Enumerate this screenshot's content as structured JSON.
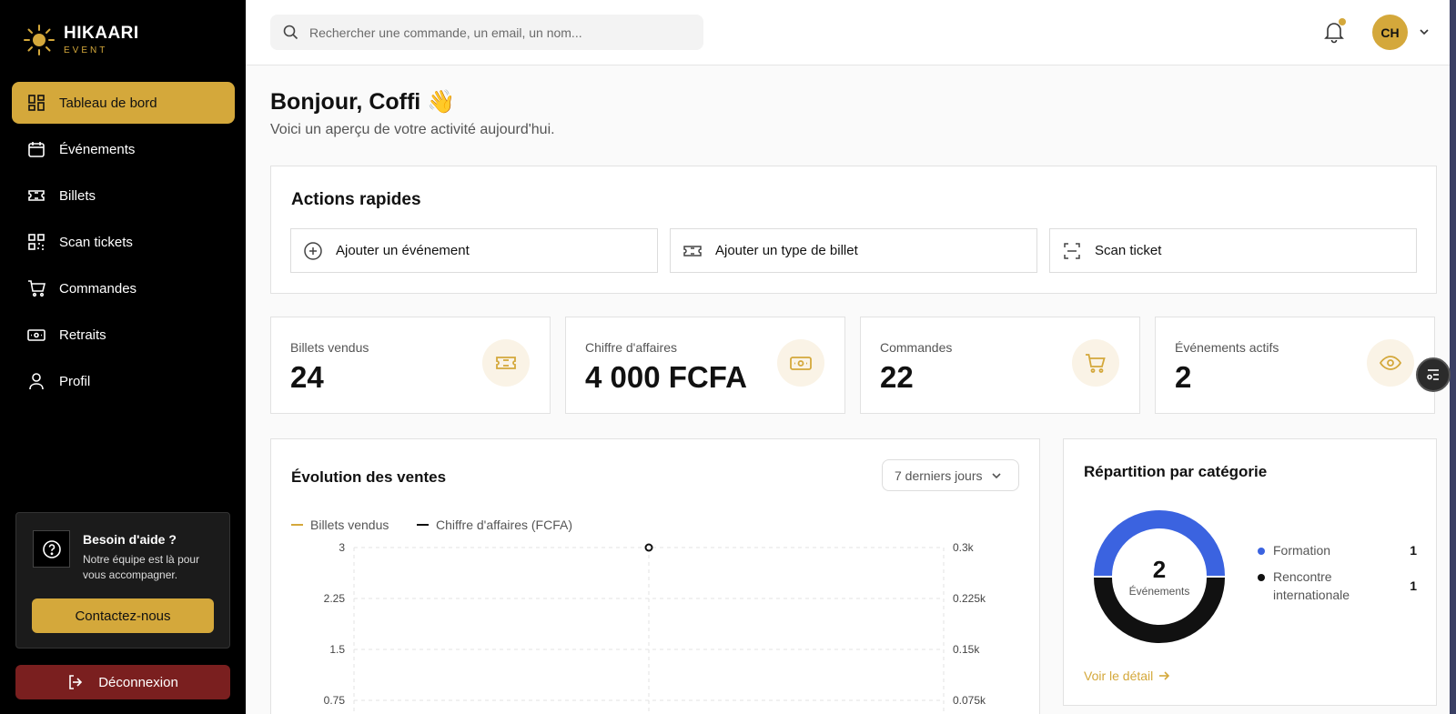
{
  "brand": {
    "name": "HIKAARI",
    "sub": "EVENT"
  },
  "sidebar": {
    "items": [
      {
        "label": "Tableau de bord",
        "icon": "dashboard-icon",
        "active": true
      },
      {
        "label": "Événements",
        "icon": "calendar-icon"
      },
      {
        "label": "Billets",
        "icon": "ticket-icon"
      },
      {
        "label": "Scan tickets",
        "icon": "qr-code-icon"
      },
      {
        "label": "Commandes",
        "icon": "cart-icon"
      },
      {
        "label": "Retraits",
        "icon": "banknote-icon"
      },
      {
        "label": "Profil",
        "icon": "user-icon"
      }
    ],
    "help": {
      "title": "Besoin d'aide ?",
      "text": "Notre équipe est là pour vous accompagner.",
      "button": "Contactez-nous"
    },
    "logout": "Déconnexion"
  },
  "topbar": {
    "search_placeholder": "Rechercher une commande, un email, un nom...",
    "avatar_initials": "CH"
  },
  "greeting": {
    "title": "Bonjour, Coffi 👋",
    "subtitle": "Voici un aperçu de votre activité aujourd'hui."
  },
  "quick_actions": {
    "title": "Actions rapides",
    "items": [
      {
        "label": "Ajouter un événement",
        "icon": "plus-circle-icon"
      },
      {
        "label": "Ajouter un type de billet",
        "icon": "ticket-icon"
      },
      {
        "label": "Scan ticket",
        "icon": "scan-icon"
      }
    ]
  },
  "stats": [
    {
      "label": "Billets vendus",
      "value": "24",
      "icon": "ticket-icon"
    },
    {
      "label": "Chiffre d'affaires",
      "value": "4 000 FCFA",
      "icon": "banknote-icon"
    },
    {
      "label": "Commandes",
      "value": "22",
      "icon": "cart-icon"
    },
    {
      "label": "Événements actifs",
      "value": "2",
      "icon": "eye-icon"
    }
  ],
  "sales_chart": {
    "title": "Évolution des ventes",
    "range": "7 derniers jours"
  },
  "chart_data": {
    "type": "line",
    "series": [
      {
        "name": "Billets vendus",
        "color": "#d4a83b",
        "axis": "left"
      },
      {
        "name": "Chiffre d'affaires (FCFA)",
        "color": "#111111",
        "axis": "right",
        "points": [
          {
            "x_fraction": 0.5,
            "y": 300
          }
        ]
      }
    ],
    "y_left_ticks": [
      "3",
      "2.25",
      "1.5",
      "0.75"
    ],
    "y_right_ticks": [
      "0.3k",
      "0.225k",
      "0.15k",
      "0.075k"
    ],
    "ylim_left": [
      0,
      3
    ],
    "ylim_right": [
      0,
      300
    ],
    "grid": true
  },
  "category_chart": {
    "title": "Répartition par catégorie",
    "total": "2",
    "total_label": "Événements",
    "items": [
      {
        "name": "Formation",
        "count": "1",
        "color": "#3b63e0"
      },
      {
        "name": "Rencontre internationale",
        "count": "1",
        "color": "#111111"
      }
    ],
    "link": "Voir le détail"
  },
  "colors": {
    "accent": "#d4a83b",
    "danger": "#7a1f1f",
    "blue": "#3b63e0"
  }
}
